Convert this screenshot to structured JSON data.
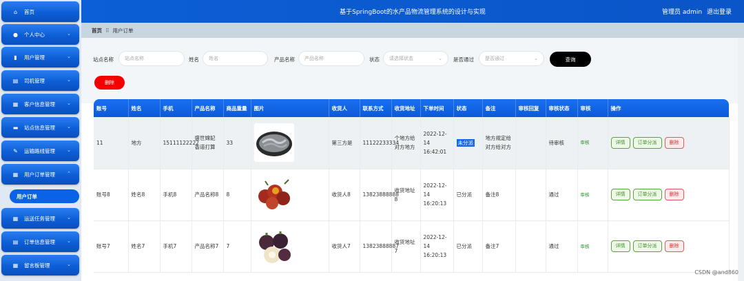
{
  "header": {
    "title": "基于SpringBoot的水产品物流管理系统的设计与实现",
    "user_label": "管理员 admin",
    "logout_label": "退出登录"
  },
  "sidebar": {
    "items": [
      {
        "label": "首页",
        "icon": "home-icon",
        "chevron": ""
      },
      {
        "label": "个人中心",
        "icon": "user-icon",
        "chevron": "⌄"
      },
      {
        "label": "用户管理",
        "icon": "chart-icon",
        "chevron": "⌄"
      },
      {
        "label": "司机管理",
        "icon": "doc-icon",
        "chevron": "⌄"
      },
      {
        "label": "客户信息管理",
        "icon": "grid-icon",
        "chevron": "⌄"
      },
      {
        "label": "站点信息管理",
        "icon": "chat-icon",
        "chevron": "⌄"
      },
      {
        "label": "运输路线管理",
        "icon": "edit-icon",
        "chevron": "⌄"
      },
      {
        "label": "用户订单管理",
        "icon": "grid-icon",
        "chevron": "⌃"
      },
      {
        "label": "运送任务管理",
        "icon": "grid-icon",
        "chevron": "⌄"
      },
      {
        "label": "订单信息管理",
        "icon": "doc-icon",
        "chevron": "⌄"
      },
      {
        "label": "留言板管理",
        "icon": "grid-icon",
        "chevron": "⌄"
      }
    ],
    "active_subitem": "用户订单"
  },
  "breadcrumb": {
    "home": "首页",
    "separator": "⠿",
    "current": "用户订单"
  },
  "search": {
    "site_label": "站点名称",
    "site_placeholder": "站点名称",
    "name_label": "姓名",
    "name_placeholder": "姓名",
    "product_label": "产品名称",
    "product_placeholder": "产品名称",
    "status_label": "状态",
    "status_placeholder": "请选择状态",
    "approved_label": "是否通过",
    "approved_placeholder": "是否通过",
    "query_button": "查询",
    "delete_button": "删除"
  },
  "table": {
    "headers": [
      "账号",
      "姓名",
      "手机",
      "产品名称",
      "商品重量",
      "图片",
      "收货人",
      "联系方式",
      "收货地址",
      "下单时间",
      "状态",
      "备注",
      "审核回复",
      "审核状态",
      "审核",
      "操作"
    ],
    "rows": [
      {
        "account": "11",
        "name": "地方",
        "phone": "15111122222",
        "product": "盛世嫦妃香道打算",
        "weight": "33",
        "image": "shrimp",
        "receiver": "第三方是",
        "contact": "11122233334",
        "address": "个地方给对方地方",
        "time": "2022-12-14 16:42:01",
        "status": "未分派",
        "note": "地方规定给对方给对方",
        "reply": "",
        "audit_status": "待审核",
        "audit": "审核"
      },
      {
        "account": "账号8",
        "name": "姓名8",
        "phone": "手机8",
        "product": "产品名称8",
        "weight": "8",
        "image": "fruit",
        "receiver": "收货人8",
        "contact": "13823888888",
        "address": "收货地址8",
        "time": "2022-12-14 16:20:13",
        "status": "已分派",
        "note": "备注8",
        "reply": "",
        "audit_status": "通过",
        "audit": "审核"
      },
      {
        "account": "账号7",
        "name": "姓名7",
        "phone": "手机7",
        "product": "产品名称7",
        "weight": "7",
        "image": "mangosteen",
        "receiver": "收货人7",
        "contact": "13823888887",
        "address": "收货地址7",
        "time": "2022-12-14 16:20:13",
        "status": "已分派",
        "note": "备注7",
        "reply": "",
        "audit_status": "通过",
        "audit": "审核"
      }
    ],
    "ops": {
      "detail": "详情",
      "dispatch": "订单分派",
      "delete": "删除"
    }
  },
  "watermark": "CSDN @and860"
}
